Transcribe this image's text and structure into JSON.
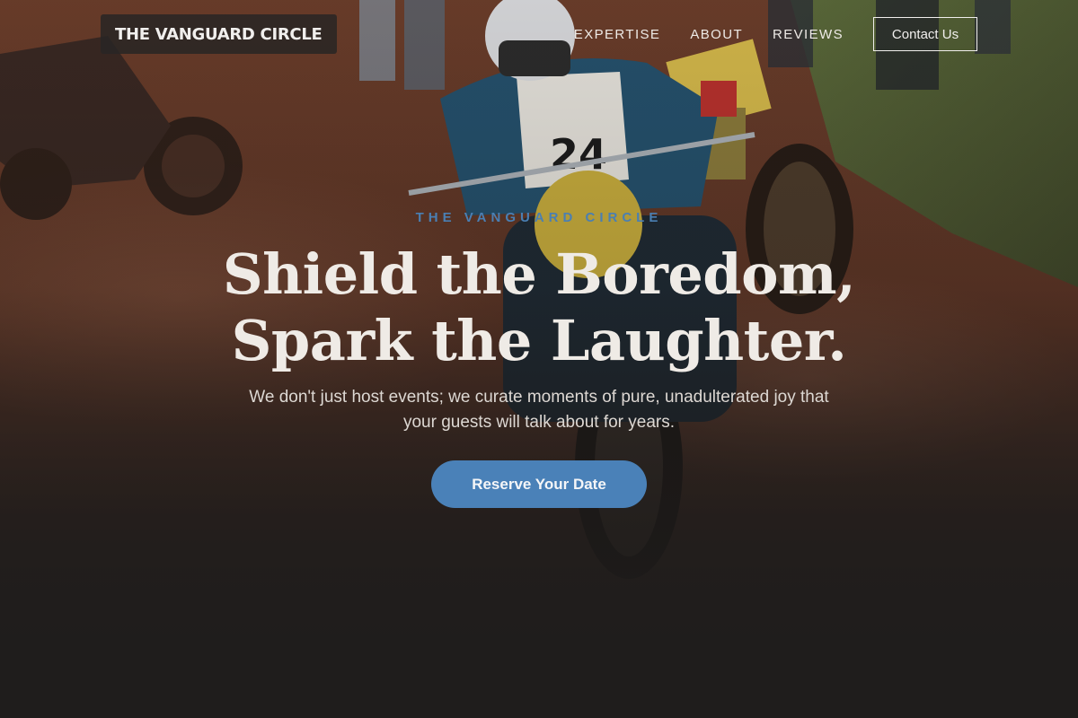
{
  "brand": {
    "name": "THE VANGUARD CIRCLE"
  },
  "nav": {
    "links": [
      "EXPERTISE",
      "ABOUT",
      "REVIEWS"
    ],
    "contact_label": "Contact Us"
  },
  "hero": {
    "eyebrow": "THE VANGUARD CIRCLE",
    "headline_line1": "Shield the Boredom,",
    "headline_line2": "Spark the Laughter.",
    "subtitle": "We don't just host events; we curate moments of pure, unadulterated joy that your guests will talk about for years.",
    "cta_label": "Reserve Your Date"
  },
  "colors": {
    "accent": "#4a81b8",
    "eyebrow": "#4a7fb3",
    "heading": "#efebe6",
    "background": "#1f1d1c"
  },
  "icons": [
    "background-photo-motorcycle-race"
  ]
}
